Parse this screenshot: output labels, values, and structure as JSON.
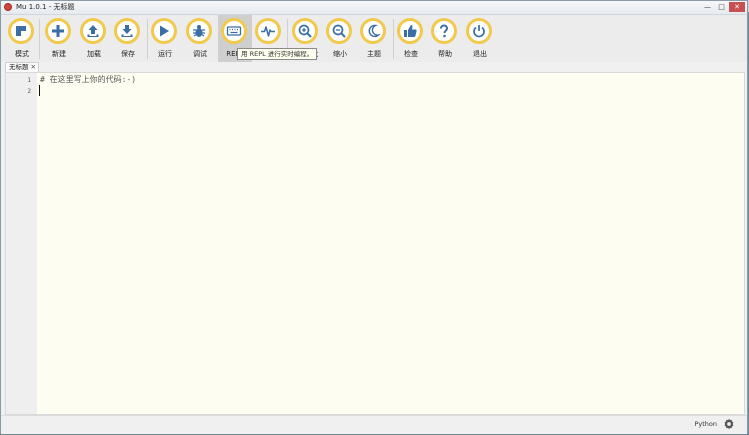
{
  "window": {
    "title": "Mu 1.0.1 - 无标题",
    "controls": [
      "—",
      "□",
      "✕"
    ]
  },
  "toolbar": {
    "buttons": [
      {
        "id": "mode",
        "label": "模式",
        "icon": "mode-icon"
      },
      {
        "id": "new",
        "label": "新建",
        "icon": "plus-icon"
      },
      {
        "id": "load",
        "label": "加载",
        "icon": "upload-icon"
      },
      {
        "id": "save",
        "label": "保存",
        "icon": "download-icon"
      },
      {
        "id": "run",
        "label": "运行",
        "icon": "play-icon"
      },
      {
        "id": "debug",
        "label": "调试",
        "icon": "bug-icon"
      },
      {
        "id": "repl",
        "label": "REPL",
        "icon": "keyboard-icon",
        "active": true
      },
      {
        "id": "plotter",
        "label": "",
        "icon": "pulse-icon"
      },
      {
        "id": "zoom-in",
        "label": "大",
        "icon": "zoom-in-icon"
      },
      {
        "id": "zoom-out",
        "label": "缩小",
        "icon": "zoom-out-icon"
      },
      {
        "id": "theme",
        "label": "主题",
        "icon": "moon-icon"
      },
      {
        "id": "check",
        "label": "检查",
        "icon": "thumbs-up-icon"
      },
      {
        "id": "help",
        "label": "帮助",
        "icon": "question-icon"
      },
      {
        "id": "quit",
        "label": "退出",
        "icon": "power-icon"
      }
    ],
    "tooltip": "用 REPL 进行实时编程。"
  },
  "tabs": [
    {
      "label": "无标题",
      "close": "✕"
    }
  ],
  "editor": {
    "line_numbers": [
      "1",
      "2"
    ],
    "lines": [
      "# 在这里写上你的代码:-)",
      ""
    ]
  },
  "status": {
    "mode": "Python",
    "settings_icon": "gear-icon"
  },
  "colors": {
    "icon_blue": "#3a6ea5",
    "ring_yellow": "#f2c94c",
    "editor_bg": "#fefdf2"
  }
}
